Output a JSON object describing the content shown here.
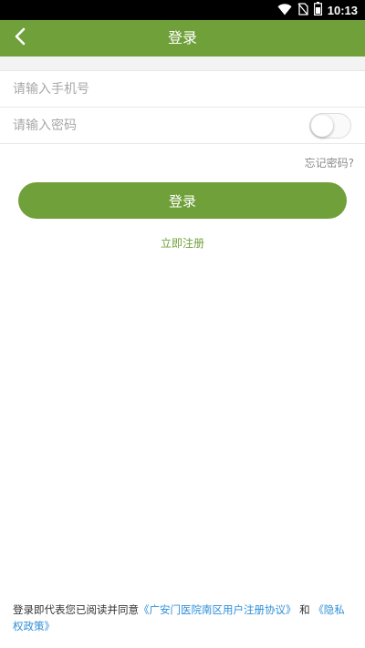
{
  "status_bar": {
    "time": "10:13",
    "icons": [
      "wifi-icon",
      "no-sim-icon",
      "battery-icon"
    ]
  },
  "nav": {
    "back_icon": "chevron-left-icon",
    "title": "登录"
  },
  "form": {
    "phone_placeholder": "请输入手机号",
    "password_placeholder": "请输入密码",
    "show_password_toggle": false,
    "forgot_label": "忘记密码?",
    "login_label": "登录",
    "register_label": "立即注册"
  },
  "agreement": {
    "prefix": "登录即代表您已阅读并同意",
    "user_agreement": "《广安门医院南区用户注册协议》",
    "conjunction": " 和 ",
    "privacy_policy": "《隐私权政策》"
  },
  "colors": {
    "brand_green": "#70a03a",
    "link_blue": "#2f8fd8",
    "placeholder_gray": "#a8a8a8"
  }
}
